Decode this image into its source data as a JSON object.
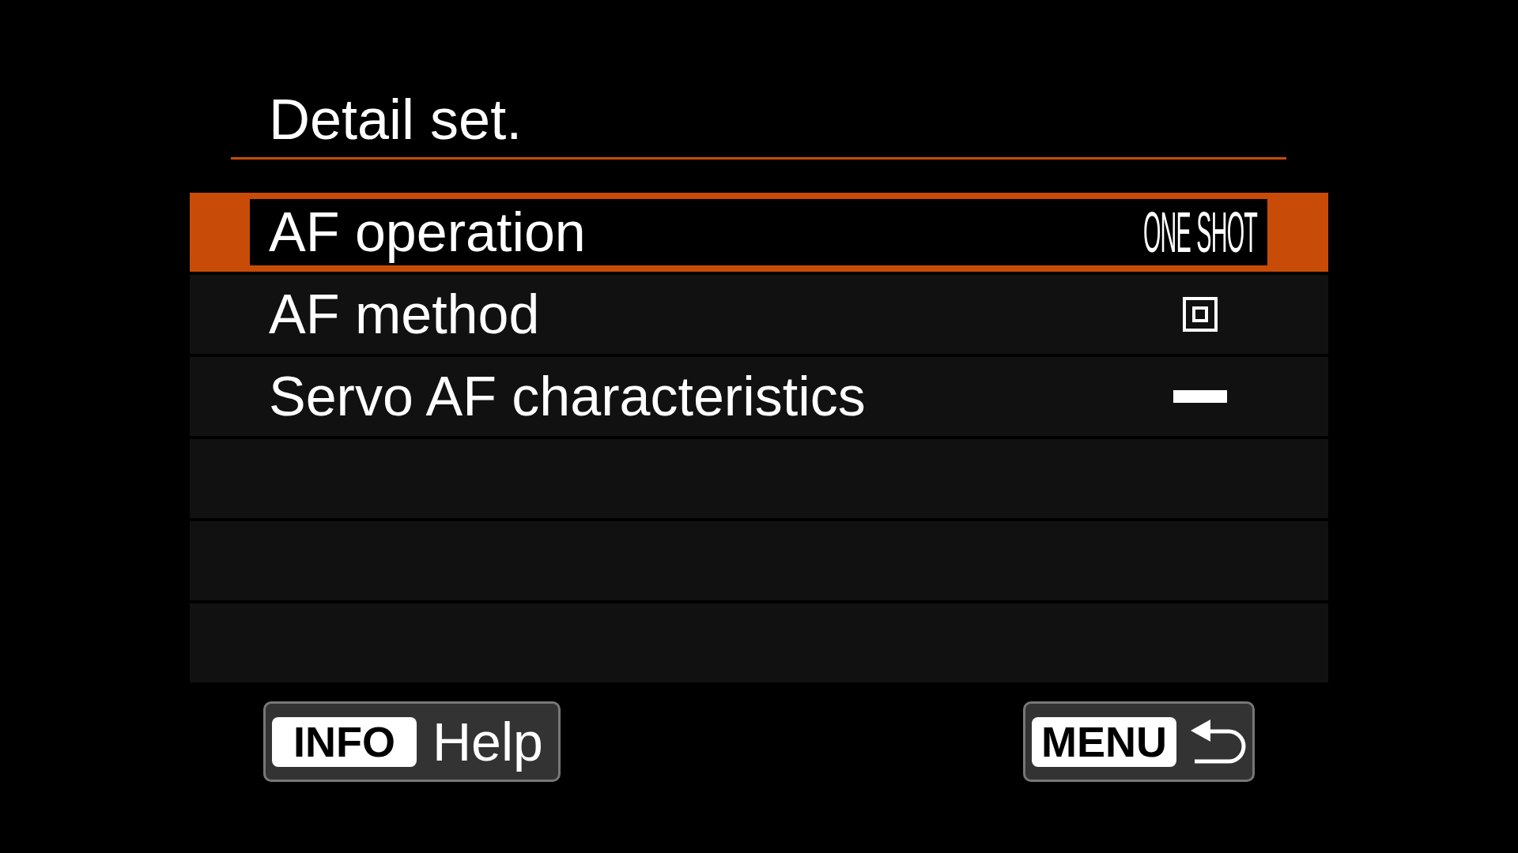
{
  "title": "Detail set.",
  "items": [
    {
      "kind": "text",
      "label": "AF operation",
      "value": "ONE SHOT",
      "selected": true
    },
    {
      "kind": "point",
      "label": "AF method",
      "selected": false
    },
    {
      "kind": "dash",
      "label": "Servo AF characteristics",
      "selected": false
    }
  ],
  "footer": {
    "help": {
      "key": "INFO",
      "label": "Help"
    },
    "back": {
      "key": "MENU"
    }
  }
}
